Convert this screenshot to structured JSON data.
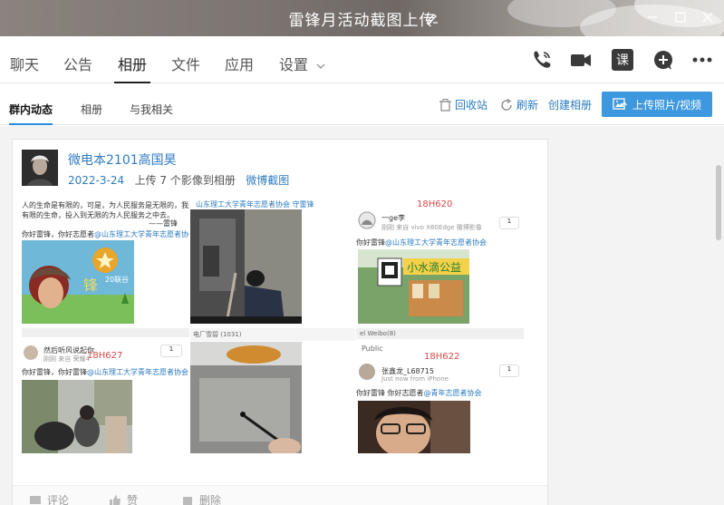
{
  "window": {
    "title": "雷锋月活动截图上传"
  },
  "main_tabs": [
    {
      "label": "聊天"
    },
    {
      "label": "公告"
    },
    {
      "label": "相册"
    },
    {
      "label": "文件"
    },
    {
      "label": "应用"
    },
    {
      "label": "设置"
    }
  ],
  "toolbar_icons": {
    "class_label": "课"
  },
  "sub_tabs": [
    {
      "label": "群内动态"
    },
    {
      "label": "相册"
    },
    {
      "label": "与我相关"
    }
  ],
  "actions": {
    "recycle": "回收站",
    "refresh": "刷新",
    "create_album": "创建相册",
    "upload": "上传照片/视频"
  },
  "post": {
    "author": "微电本2101高国昊",
    "date": "2022-3-24",
    "action_text": "上传 7 个影像到相册",
    "album": "微博截图"
  },
  "photos": {
    "p1": {
      "line1": "人的生命是有限的，可是，为人民服务是无限的，我要",
      "line2": "有限的生命，投入到无限的为人民服务之中去。",
      "line3": "——雷锋",
      "greet": "你好雷锋，你好志愿者",
      "mention": "@山东理工大学青年志愿者协会",
      "badge": "20联谷"
    },
    "p2": {
      "header": "山东理工大学青年志愿者协会 守雷锋"
    },
    "p3": {
      "tag": "18H620",
      "user": "一ge李",
      "device": "刚刚 来自 vivo X60Edge 微博影像",
      "greet": "你好雷锋",
      "mention": "@山东理工大学青年志愿者协会",
      "count": "1"
    },
    "p4": {
      "tag": "18H627",
      "user": "然后听风说起你",
      "sub": "刚刚 来自 荣耀4",
      "greet": "你好雷锋，你好雷锋",
      "mention": "@山东理工大学青年志愿者协会",
      "count": "1"
    },
    "p5": {
      "header": "电厂雪碧 (1031)"
    },
    "p6": {
      "tag": "18H622",
      "public": "Public",
      "topbar": "el Weibo(8)",
      "user": "张鑫龙_L68715",
      "sub": "Just now  from iPhone",
      "greet": "你好雷锋 你好志愿者",
      "mention": "@青年志愿者协会",
      "count": "1"
    }
  },
  "footer": {
    "comment": "评论",
    "like": "赞",
    "delete": "删除"
  },
  "colors": {
    "accent": "#3d98e0",
    "link": "#2f7bc0"
  }
}
